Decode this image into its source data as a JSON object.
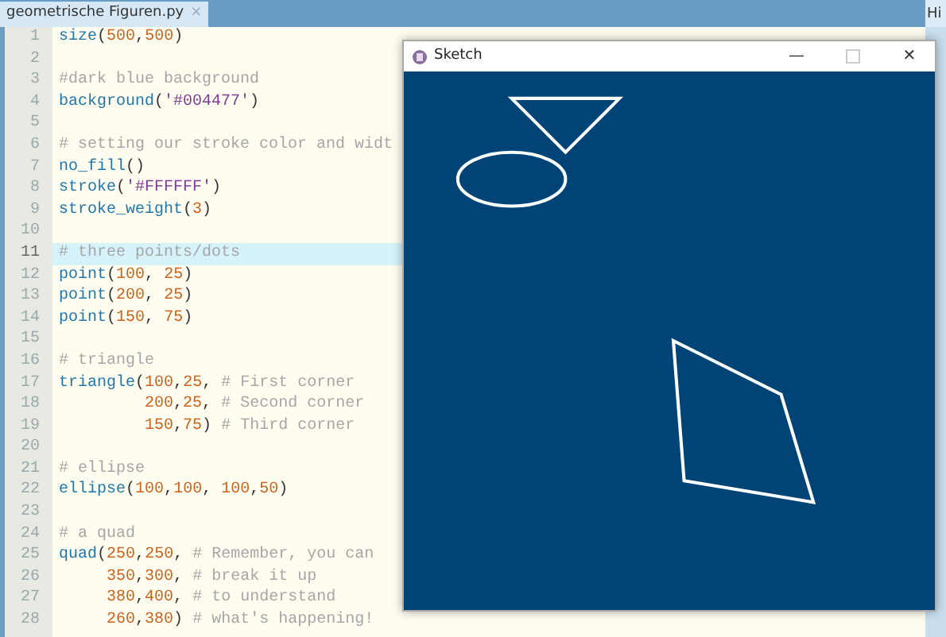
{
  "editor": {
    "tab": {
      "label": "geometrische Figuren.py",
      "close": "×"
    },
    "lines": [
      {
        "number": "1",
        "selected": false,
        "tokens": [
          {
            "kind": "fn",
            "text": "size"
          },
          {
            "kind": "punct",
            "text": "("
          },
          {
            "kind": "num",
            "text": "500"
          },
          {
            "kind": "punct",
            "text": ","
          },
          {
            "kind": "num",
            "text": "500"
          },
          {
            "kind": "punct",
            "text": ")"
          }
        ]
      },
      {
        "number": "2",
        "selected": false
      },
      {
        "number": "3",
        "selected": false,
        "tokens": [
          {
            "kind": "comment",
            "text": "#dark blue background"
          }
        ]
      },
      {
        "number": "4",
        "selected": false,
        "tokens": [
          {
            "kind": "fn",
            "text": "background"
          },
          {
            "kind": "punct",
            "text": "("
          },
          {
            "kind": "str",
            "text": "'#004477'"
          },
          {
            "kind": "punct",
            "text": ")"
          }
        ]
      },
      {
        "number": "5",
        "selected": false
      },
      {
        "number": "6",
        "selected": false,
        "tokens": [
          {
            "kind": "comment",
            "text": "# setting our stroke color and widt"
          }
        ]
      },
      {
        "number": "7",
        "selected": false,
        "tokens": [
          {
            "kind": "fn",
            "text": "no_fill"
          },
          {
            "kind": "punct",
            "text": "()"
          }
        ]
      },
      {
        "number": "8",
        "selected": false,
        "tokens": [
          {
            "kind": "fn",
            "text": "stroke"
          },
          {
            "kind": "punct",
            "text": "("
          },
          {
            "kind": "str",
            "text": "'#FFFFFF'"
          },
          {
            "kind": "punct",
            "text": ")"
          }
        ]
      },
      {
        "number": "9",
        "selected": false,
        "tokens": [
          {
            "kind": "fn",
            "text": "stroke_weight"
          },
          {
            "kind": "punct",
            "text": "("
          },
          {
            "kind": "num",
            "text": "3"
          },
          {
            "kind": "punct",
            "text": ")"
          }
        ]
      },
      {
        "number": "10",
        "selected": false
      },
      {
        "number": "11",
        "selected": true,
        "tokens": [
          {
            "kind": "comment",
            "text": "# three points/dots"
          }
        ]
      },
      {
        "number": "12",
        "selected": false,
        "tokens": [
          {
            "kind": "fn",
            "text": "point"
          },
          {
            "kind": "punct",
            "text": "("
          },
          {
            "kind": "num",
            "text": "100"
          },
          {
            "kind": "punct",
            "text": ", "
          },
          {
            "kind": "num",
            "text": "25"
          },
          {
            "kind": "punct",
            "text": ")"
          }
        ]
      },
      {
        "number": "13",
        "selected": false,
        "tokens": [
          {
            "kind": "fn",
            "text": "point"
          },
          {
            "kind": "punct",
            "text": "("
          },
          {
            "kind": "num",
            "text": "200"
          },
          {
            "kind": "punct",
            "text": ", "
          },
          {
            "kind": "num",
            "text": "25"
          },
          {
            "kind": "punct",
            "text": ")"
          }
        ]
      },
      {
        "number": "14",
        "selected": false,
        "tokens": [
          {
            "kind": "fn",
            "text": "point"
          },
          {
            "kind": "punct",
            "text": "("
          },
          {
            "kind": "num",
            "text": "150"
          },
          {
            "kind": "punct",
            "text": ", "
          },
          {
            "kind": "num",
            "text": "75"
          },
          {
            "kind": "punct",
            "text": ")"
          }
        ]
      },
      {
        "number": "15",
        "selected": false
      },
      {
        "number": "16",
        "selected": false,
        "tokens": [
          {
            "kind": "comment",
            "text": "# triangle"
          }
        ]
      },
      {
        "number": "17",
        "selected": false,
        "tokens": [
          {
            "kind": "fn",
            "text": "triangle"
          },
          {
            "kind": "punct",
            "text": "("
          },
          {
            "kind": "num",
            "text": "100"
          },
          {
            "kind": "punct",
            "text": ","
          },
          {
            "kind": "num",
            "text": "25"
          },
          {
            "kind": "punct",
            "text": ", "
          },
          {
            "kind": "comment",
            "text": "# First corner"
          }
        ]
      },
      {
        "number": "18",
        "selected": false,
        "kind": "continuation",
        "tokens": [
          {
            "kind": "num",
            "text": "200"
          },
          {
            "kind": "punct",
            "text": ","
          },
          {
            "kind": "num",
            "text": "25"
          },
          {
            "kind": "punct",
            "text": ", "
          },
          {
            "kind": "comment",
            "text": "# Second corner"
          }
        ]
      },
      {
        "number": "19",
        "selected": false,
        "kind": "continuation",
        "tokens": [
          {
            "kind": "num",
            "text": "150"
          },
          {
            "kind": "punct",
            "text": ","
          },
          {
            "kind": "num",
            "text": "75"
          },
          {
            "kind": "punct",
            "text": ") "
          },
          {
            "kind": "comment",
            "text": "# Third corner"
          }
        ]
      },
      {
        "number": "20",
        "selected": false
      },
      {
        "number": "21",
        "selected": false,
        "tokens": [
          {
            "kind": "comment",
            "text": "# ellipse"
          }
        ]
      },
      {
        "number": "22",
        "selected": false,
        "tokens": [
          {
            "kind": "fn",
            "text": "ellipse"
          },
          {
            "kind": "punct",
            "text": "("
          },
          {
            "kind": "num",
            "text": "100"
          },
          {
            "kind": "punct",
            "text": ","
          },
          {
            "kind": "num",
            "text": "100"
          },
          {
            "kind": "punct",
            "text": ", "
          },
          {
            "kind": "num",
            "text": "100"
          },
          {
            "kind": "punct",
            "text": ","
          },
          {
            "kind": "num",
            "text": "50"
          },
          {
            "kind": "punct",
            "text": ")"
          }
        ]
      },
      {
        "number": "23",
        "selected": false
      },
      {
        "number": "24",
        "selected": false,
        "tokens": [
          {
            "kind": "comment",
            "text": "# a quad"
          }
        ]
      },
      {
        "number": "25",
        "selected": false,
        "tokens": [
          {
            "kind": "fn",
            "text": "quad"
          },
          {
            "kind": "punct",
            "text": "("
          },
          {
            "kind": "num",
            "text": "250"
          },
          {
            "kind": "punct",
            "text": ","
          },
          {
            "kind": "num",
            "text": "250"
          },
          {
            "kind": "punct",
            "text": ", "
          },
          {
            "kind": "comment",
            "text": "# Remember, you can"
          }
        ]
      },
      {
        "number": "26",
        "selected": false,
        "kind": "continuation",
        "tokens": [
          {
            "kind": "num",
            "text": "350"
          },
          {
            "kind": "punct",
            "text": ","
          },
          {
            "kind": "num",
            "text": "300"
          },
          {
            "kind": "punct",
            "text": ", "
          },
          {
            "kind": "comment",
            "text": "# break it up"
          }
        ]
      },
      {
        "number": "27",
        "selected": false,
        "kind": "continuation",
        "tokens": [
          {
            "kind": "num",
            "text": "380"
          },
          {
            "kind": "punct",
            "text": ","
          },
          {
            "kind": "num",
            "text": "400"
          },
          {
            "kind": "punct",
            "text": ", "
          },
          {
            "kind": "comment",
            "text": "# to understand"
          }
        ]
      },
      {
        "number": "28",
        "selected": false,
        "kind": "continuation",
        "tokens": [
          {
            "kind": "num",
            "text": "260"
          },
          {
            "kind": "punct",
            "text": ","
          },
          {
            "kind": "num",
            "text": "380"
          },
          {
            "kind": "punct",
            "text": ") "
          },
          {
            "kind": "comment",
            "text": "# what's happening!"
          }
        ]
      }
    ]
  },
  "side_panel": {
    "tab": "Hi"
  },
  "sketch_window": {
    "title": "Sketch",
    "minimize": "—",
    "close": "✕"
  }
}
